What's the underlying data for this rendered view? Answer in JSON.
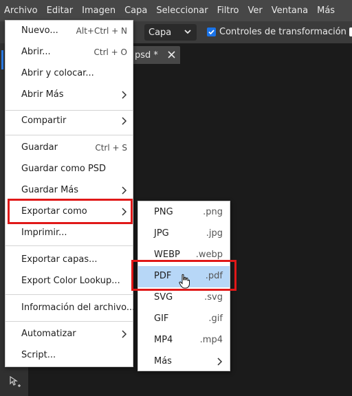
{
  "menubar": {
    "items": [
      "Archivo",
      "Editar",
      "Imagen",
      "Capa",
      "Seleccionar",
      "Filtro",
      "Ver",
      "Ventana",
      "Más"
    ]
  },
  "options": {
    "select_value": "Capa",
    "checkbox_label": "Controles de transformación",
    "checkbox_checked": true
  },
  "document_tab": {
    "label": "psd *"
  },
  "file_menu": {
    "items": [
      {
        "label": "Nuevo...",
        "shortcut": "Alt+Ctrl + N"
      },
      {
        "label": "Abrir...",
        "shortcut": "Ctrl + O"
      },
      {
        "label": "Abrir y colocar..."
      },
      {
        "label": "Abrir Más",
        "submenu": true
      },
      {
        "label": "Compartir",
        "submenu": true
      },
      {
        "label": "Guardar",
        "shortcut": "Ctrl + S"
      },
      {
        "label": "Guardar como PSD"
      },
      {
        "label": "Guardar Más",
        "submenu": true
      },
      {
        "label": "Exportar como",
        "submenu": true,
        "highlighted": true
      },
      {
        "label": "Imprimir..."
      },
      {
        "label": "Exportar capas..."
      },
      {
        "label": "Export Color Lookup..."
      },
      {
        "label": "Información del archivo..."
      },
      {
        "label": "Automatizar",
        "submenu": true
      },
      {
        "label": "Script...",
        "submenu": false
      }
    ]
  },
  "export_submenu": {
    "items": [
      {
        "label": "PNG",
        "ext": ".png"
      },
      {
        "label": "JPG",
        "ext": ".jpg"
      },
      {
        "label": "WEBP",
        "ext": ".webp"
      },
      {
        "label": "PDF",
        "ext": ".pdf",
        "active": true
      },
      {
        "label": "SVG",
        "ext": ".svg"
      },
      {
        "label": "GIF",
        "ext": ".gif"
      },
      {
        "label": "MP4",
        "ext": ".mp4"
      },
      {
        "label": "Más",
        "submenu": true
      }
    ]
  },
  "colors": {
    "menubar_bg": "#474747",
    "highlight_border": "#e01818",
    "active_item_bg": "#b7d7f7",
    "checkbox_accent": "#1a73e8"
  }
}
